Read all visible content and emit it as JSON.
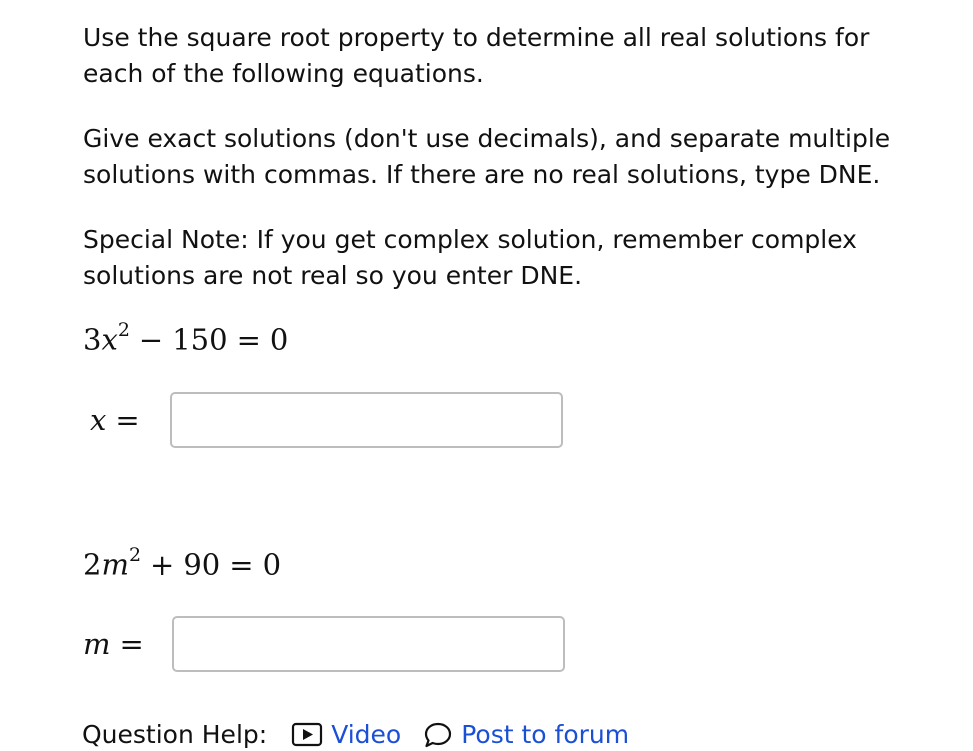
{
  "instructions": {
    "p1": [
      "Use the square root property to determine all real solutions for",
      "each of the following equations."
    ],
    "p2": [
      "Give exact solutions (don't use decimals), and separate multiple",
      "solutions with commas. If there are no real solutions, type DNE."
    ],
    "p3": [
      "Special Note: If you get complex solution, remember complex",
      "solutions are not real so you enter DNE."
    ]
  },
  "problems": [
    {
      "coefficient": "3",
      "variable": "x",
      "exponent": "2",
      "operator": "−",
      "constant": "150",
      "equals": "=",
      "rhs": "0",
      "answer_label": "x",
      "answer_value": ""
    },
    {
      "coefficient": "2",
      "variable": "m",
      "exponent": "2",
      "operator": "+",
      "constant": "90",
      "equals": "=",
      "rhs": "0",
      "answer_label": "m",
      "answer_value": ""
    }
  ],
  "help": {
    "label": "Question Help:",
    "video_label": "Video",
    "video_icon": "video-icon",
    "forum_label": "Post to forum",
    "forum_icon": "chat-bubble-icon",
    "link_color": "#1a4fd6"
  }
}
